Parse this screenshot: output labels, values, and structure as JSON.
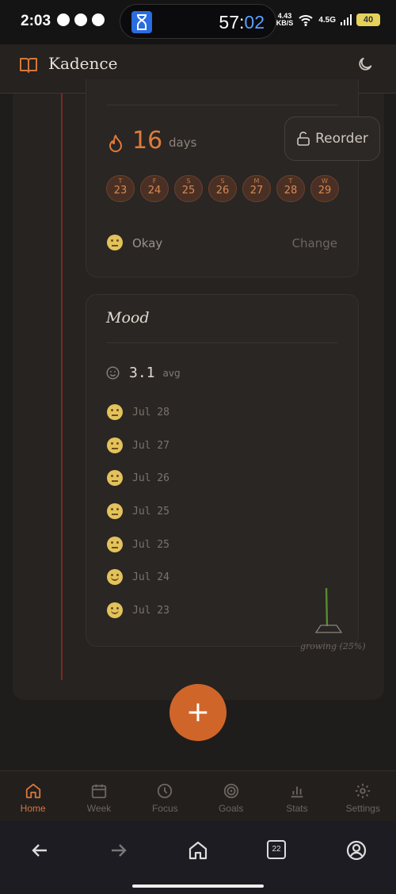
{
  "status": {
    "time": "2:03",
    "timer_min": "57:",
    "timer_sec": "02",
    "net_speed": "4.43",
    "net_unit": "KB/S",
    "network": "4.5G",
    "battery": "40"
  },
  "header": {
    "title": "Kadence",
    "logo_icon": "book-icon",
    "theme_icon": "moon-icon"
  },
  "streak": {
    "count": "16",
    "unit": "days",
    "days": [
      {
        "w": "T",
        "d": "23"
      },
      {
        "w": "F",
        "d": "24"
      },
      {
        "w": "S",
        "d": "25"
      },
      {
        "w": "S",
        "d": "26"
      },
      {
        "w": "M",
        "d": "27"
      },
      {
        "w": "T",
        "d": "28"
      },
      {
        "w": "W",
        "d": "29"
      }
    ],
    "mood_label": "Okay",
    "change_label": "Change"
  },
  "reorder_label": "Reorder",
  "mood": {
    "title": "Mood",
    "avg": "3.1",
    "avg_label": "avg",
    "entries": [
      {
        "date": "Jul 28",
        "face": "neutral"
      },
      {
        "date": "Jul 27",
        "face": "neutral"
      },
      {
        "date": "Jul 26",
        "face": "neutral"
      },
      {
        "date": "Jul 25",
        "face": "neutral"
      },
      {
        "date": "Jul 25",
        "face": "neutral"
      },
      {
        "date": "Jul 24",
        "face": "smile"
      },
      {
        "date": "Jul 23",
        "face": "smile"
      }
    ],
    "growing_label": "growing (25%)"
  },
  "fab_label": "+",
  "nav": [
    {
      "label": "Home",
      "icon": "home-icon",
      "active": true
    },
    {
      "label": "Week",
      "icon": "calendar-icon"
    },
    {
      "label": "Focus",
      "icon": "clock-icon"
    },
    {
      "label": "Goals",
      "icon": "target-icon"
    },
    {
      "label": "Stats",
      "icon": "bar-chart-icon"
    },
    {
      "label": "Settings",
      "icon": "gear-icon"
    }
  ],
  "system": {
    "tab_count": "22"
  },
  "colors": {
    "accent": "#d0652a",
    "background": "#1f1d1b"
  }
}
